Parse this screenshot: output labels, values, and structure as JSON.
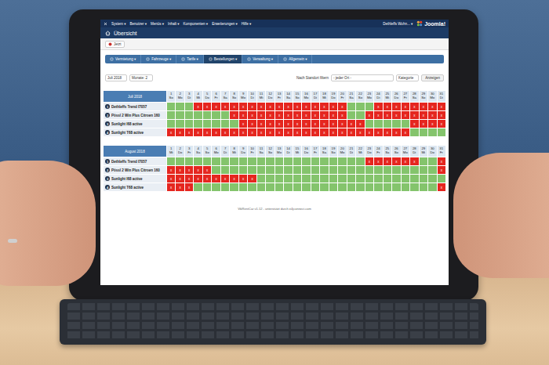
{
  "topbar": {
    "menu": [
      "System ▾",
      "Benutzer ▾",
      "Menüs ▾",
      "Inhalt ▾",
      "Komponenten ▾",
      "Erweiterungen ▾",
      "Hilfe ▾"
    ],
    "user": "Dethleffs Wohn... ▾",
    "logo": "Joomla!"
  },
  "page": {
    "title": "Übersicht"
  },
  "toolbar": {
    "button": "Jetzt"
  },
  "tabs": [
    {
      "label": "Vermietung ▾",
      "selected": false
    },
    {
      "label": "Fahrzeuge ▾",
      "selected": false
    },
    {
      "label": "Tarife ▾",
      "selected": false
    },
    {
      "label": "Bestellungen ▾",
      "selected": true
    },
    {
      "label": "Verwaltung ▾",
      "selected": false
    },
    {
      "label": "Allgemein ▾",
      "selected": false
    }
  ],
  "filters": {
    "month": "Juli 2018",
    "months": "Monate: 2",
    "location_label": "Nach Standort filtern",
    "location": "- jeder Ort -",
    "category": "Kategorie",
    "submit": "Anzeigen"
  },
  "mark": "x",
  "months": [
    {
      "title": "Juli 2018",
      "days": [
        {
          "n": "1",
          "d": "So"
        },
        {
          "n": "2",
          "d": "Mo"
        },
        {
          "n": "3",
          "d": "Di"
        },
        {
          "n": "4",
          "d": "Mi"
        },
        {
          "n": "5",
          "d": "Do"
        },
        {
          "n": "6",
          "d": "Fr"
        },
        {
          "n": "7",
          "d": "Sa"
        },
        {
          "n": "8",
          "d": "So"
        },
        {
          "n": "9",
          "d": "Mo"
        },
        {
          "n": "10",
          "d": "Di"
        },
        {
          "n": "11",
          "d": "Mi"
        },
        {
          "n": "12",
          "d": "Do"
        },
        {
          "n": "13",
          "d": "Fr"
        },
        {
          "n": "14",
          "d": "Sa"
        },
        {
          "n": "15",
          "d": "So"
        },
        {
          "n": "16",
          "d": "Mo"
        },
        {
          "n": "17",
          "d": "Di"
        },
        {
          "n": "18",
          "d": "Mi"
        },
        {
          "n": "19",
          "d": "Do"
        },
        {
          "n": "20",
          "d": "Fr"
        },
        {
          "n": "21",
          "d": "Sa"
        },
        {
          "n": "22",
          "d": "So"
        },
        {
          "n": "23",
          "d": "Mo"
        },
        {
          "n": "24",
          "d": "Di"
        },
        {
          "n": "25",
          "d": "Mi"
        },
        {
          "n": "26",
          "d": "Do"
        },
        {
          "n": "27",
          "d": "Fr"
        },
        {
          "n": "28",
          "d": "Sa"
        },
        {
          "n": "29",
          "d": "So"
        },
        {
          "n": "30",
          "d": "Mo"
        },
        {
          "n": "31",
          "d": "Di"
        }
      ],
      "rows": [
        {
          "num": "1",
          "name": "Dethleffs Trend I7057",
          "booked": [
            false,
            false,
            false,
            true,
            true,
            true,
            true,
            true,
            true,
            true,
            true,
            true,
            true,
            true,
            true,
            true,
            true,
            true,
            true,
            true,
            false,
            false,
            false,
            true,
            true,
            true,
            true,
            true,
            true,
            true,
            true
          ]
        },
        {
          "num": "2",
          "name": "Pössl 2 Win Plus Citroen 160",
          "booked": [
            false,
            false,
            false,
            false,
            false,
            false,
            false,
            true,
            true,
            true,
            true,
            true,
            true,
            true,
            true,
            true,
            true,
            true,
            true,
            true,
            false,
            false,
            true,
            true,
            true,
            true,
            true,
            true,
            true,
            true,
            true
          ]
        },
        {
          "num": "3",
          "name": "Sunlight I68 active",
          "booked": [
            false,
            false,
            false,
            false,
            false,
            false,
            false,
            false,
            true,
            true,
            true,
            true,
            true,
            true,
            true,
            true,
            true,
            true,
            true,
            true,
            true,
            true,
            false,
            false,
            false,
            false,
            false,
            true,
            true,
            true,
            true
          ]
        },
        {
          "num": "4",
          "name": "Sunlight T68 active",
          "booked": [
            true,
            true,
            true,
            true,
            true,
            true,
            true,
            true,
            true,
            true,
            true,
            true,
            true,
            true,
            true,
            true,
            true,
            true,
            true,
            true,
            true,
            true,
            true,
            true,
            true,
            true,
            true,
            false,
            false,
            false,
            false
          ]
        }
      ]
    },
    {
      "title": "August 2018",
      "days": [
        {
          "n": "1",
          "d": "Mi"
        },
        {
          "n": "2",
          "d": "Do"
        },
        {
          "n": "3",
          "d": "Fr"
        },
        {
          "n": "4",
          "d": "Sa"
        },
        {
          "n": "5",
          "d": "So"
        },
        {
          "n": "6",
          "d": "Mo"
        },
        {
          "n": "7",
          "d": "Di"
        },
        {
          "n": "8",
          "d": "Mi"
        },
        {
          "n": "9",
          "d": "Do"
        },
        {
          "n": "10",
          "d": "Fr"
        },
        {
          "n": "11",
          "d": "Sa"
        },
        {
          "n": "12",
          "d": "So"
        },
        {
          "n": "13",
          "d": "Mo"
        },
        {
          "n": "14",
          "d": "Di"
        },
        {
          "n": "15",
          "d": "Mi"
        },
        {
          "n": "16",
          "d": "Do"
        },
        {
          "n": "17",
          "d": "Fr"
        },
        {
          "n": "18",
          "d": "Sa"
        },
        {
          "n": "19",
          "d": "So"
        },
        {
          "n": "20",
          "d": "Mo"
        },
        {
          "n": "21",
          "d": "Di"
        },
        {
          "n": "22",
          "d": "Mi"
        },
        {
          "n": "23",
          "d": "Do"
        },
        {
          "n": "24",
          "d": "Fr"
        },
        {
          "n": "25",
          "d": "Sa"
        },
        {
          "n": "26",
          "d": "So"
        },
        {
          "n": "27",
          "d": "Mo"
        },
        {
          "n": "28",
          "d": "Di"
        },
        {
          "n": "29",
          "d": "Mi"
        },
        {
          "n": "30",
          "d": "Do"
        },
        {
          "n": "31",
          "d": "Fr"
        }
      ],
      "rows": [
        {
          "num": "1",
          "name": "Dethleffs Trend I7057",
          "booked": [
            false,
            false,
            false,
            false,
            false,
            false,
            false,
            false,
            false,
            false,
            false,
            false,
            false,
            false,
            false,
            false,
            false,
            false,
            false,
            false,
            false,
            false,
            true,
            true,
            true,
            true,
            true,
            true,
            false,
            false,
            true
          ]
        },
        {
          "num": "2",
          "name": "Pössl 2 Win Plus Citroen 160",
          "booked": [
            true,
            true,
            true,
            true,
            true,
            false,
            false,
            false,
            false,
            false,
            false,
            false,
            false,
            false,
            false,
            false,
            false,
            false,
            false,
            false,
            false,
            false,
            false,
            false,
            false,
            false,
            false,
            false,
            false,
            false,
            true
          ]
        },
        {
          "num": "3",
          "name": "Sunlight I68 active",
          "booked": [
            true,
            true,
            true,
            true,
            true,
            true,
            true,
            true,
            true,
            true,
            false,
            false,
            false,
            false,
            false,
            false,
            false,
            false,
            false,
            false,
            false,
            false,
            false,
            false,
            false,
            false,
            false,
            false,
            false,
            false,
            false
          ]
        },
        {
          "num": "4",
          "name": "Sunlight T68 active",
          "booked": [
            true,
            true,
            true,
            false,
            false,
            false,
            false,
            false,
            false,
            false,
            false,
            false,
            false,
            false,
            false,
            false,
            false,
            false,
            false,
            false,
            false,
            false,
            false,
            false,
            false,
            false,
            false,
            false,
            false,
            false,
            true
          ]
        }
      ]
    }
  ],
  "footer": "VikRentCar v1.12 - unterstützt durch e4jconnect.com"
}
